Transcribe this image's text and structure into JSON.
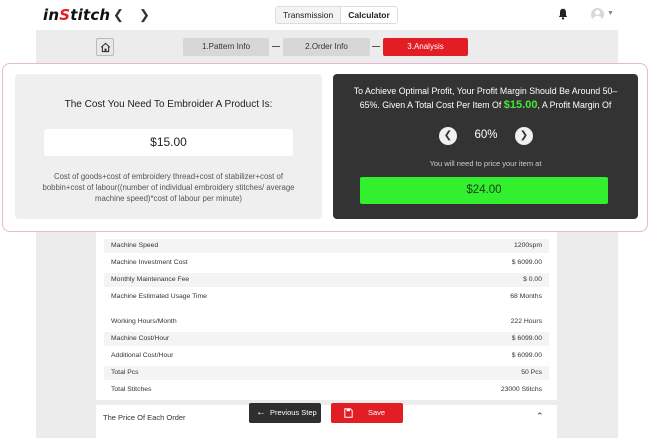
{
  "app": {
    "logo_prefix": "in",
    "logo_accent": "S",
    "logo_suffix": "titch"
  },
  "header": {
    "tabs": [
      {
        "label": "Transmission",
        "active": false
      },
      {
        "label": "Calculator",
        "active": true
      }
    ]
  },
  "steps": [
    {
      "label": "1.Pattern Info",
      "active": false
    },
    {
      "label": "2.Order Info",
      "active": false
    },
    {
      "label": "3.Analysis",
      "active": true
    }
  ],
  "cost_card": {
    "title": "The Cost You Need To Embroider A Product Is:",
    "value": "$15.00",
    "formula": "Cost of goods+cost of embroidery thread+cost of stabilizer+cost of bobbin+cost of labour((number of individual embroidery stitches/ average machine speed)*cost of labour per minute)"
  },
  "profit_card": {
    "text_before": "To Achieve Optimal Profit, Your Profit Margin Should Be Around 50–65%. Given A Total Cost Per Item Of ",
    "cost_highlight": "$15.00",
    "text_after": ", A Profit Margin Of",
    "margin": "60%",
    "note": "You will need to price your item at",
    "price": "$24.00"
  },
  "table": {
    "rows": [
      {
        "label": "Machine Speed",
        "value": "1200spm"
      },
      {
        "label": "Machine Investment Cost",
        "value": "$ 6099.00"
      },
      {
        "label": "Monthly Maintenance Fee",
        "value": "$ 0.00"
      },
      {
        "label": "Machine Estimated Usage Time",
        "value": "68 Months"
      },
      {
        "label": "Working Hours/Month",
        "value": "222 Hours"
      },
      {
        "label": "Machine Cost/Hour",
        "value": "$ 6099.00"
      },
      {
        "label": "Additional Cost/Hour",
        "value": "$ 6099.00"
      },
      {
        "label": "Total Pcs",
        "value": "50 Pcs"
      },
      {
        "label": "Total Stitches",
        "value": "23000 Stitchs"
      }
    ]
  },
  "section": {
    "label": "The Price Of Each Order"
  },
  "actions": {
    "prev_label": "Previous Step",
    "save_label": "Save"
  },
  "colors": {
    "accent": "#e21d24",
    "price_green": "#33f02f",
    "highlight_green": "#44e838",
    "dark_card": "#333333"
  }
}
